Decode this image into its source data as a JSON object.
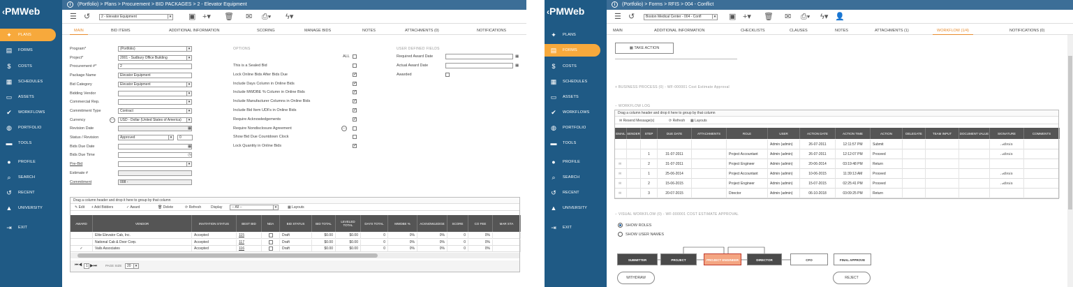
{
  "sidebar": {
    "logo": "PMWeb",
    "items": [
      {
        "label": "PLANS",
        "icon": "bulb-icon"
      },
      {
        "label": "FORMS",
        "icon": "forms-icon"
      },
      {
        "label": "COSTS",
        "icon": "dollar-icon"
      },
      {
        "label": "SCHEDULES",
        "icon": "calendar-icon"
      },
      {
        "label": "ASSETS",
        "icon": "assets-icon"
      },
      {
        "label": "WORKFLOWS",
        "icon": "check-icon"
      },
      {
        "label": "PORTFOLIO",
        "icon": "globe-icon"
      },
      {
        "label": "TOOLS",
        "icon": "toolbox-icon"
      },
      {
        "label": "PROFILE",
        "icon": "avatar-icon"
      },
      {
        "label": "SEARCH",
        "icon": "search-icon"
      },
      {
        "label": "RECENT",
        "icon": "history-icon"
      },
      {
        "label": "UNIVERSITY",
        "icon": "graduation-icon"
      },
      {
        "label": "EXIT",
        "icon": "exit-icon"
      }
    ]
  },
  "left": {
    "breadcrumb": "(Portfolio) > Plans > Procurement > BID PACKAGES > 2 - Elevator Equipment",
    "record_select": "2 - Elevator Equipment",
    "tabs": [
      "MAIN",
      "BID ITEMS",
      "ADDITIONAL INFORMATION",
      "SCORING",
      "MANAGE BIDS",
      "NOTES",
      "ATTACHMENTS (0)",
      "NOTIFICATIONS"
    ],
    "fields": [
      {
        "label": "Program*",
        "value": "(Portfolio)"
      },
      {
        "label": "Project*",
        "value": "2001 - Sudbury Office Building"
      },
      {
        "label": "Procurement #*",
        "value": "2"
      },
      {
        "label": "Package Name",
        "value": "Elevator Equipment"
      },
      {
        "label": "Bid Category",
        "value": "Elevator Equipment"
      },
      {
        "label": "Bidding Vendor",
        "value": ""
      },
      {
        "label": "Commercial Rep.",
        "value": ""
      },
      {
        "label": "Commitment Type",
        "value": "Contract"
      },
      {
        "label": "Currency",
        "value": "USD - Dollar (United States of America)"
      },
      {
        "label": "Revision Date",
        "value": ""
      },
      {
        "label": "Status / Revision",
        "value": "Approved",
        "rev": "0"
      },
      {
        "label": "Bids Due Date",
        "value": ""
      },
      {
        "label": "Bids Due Time",
        "value": ""
      },
      {
        "label": "Pre-Bid",
        "value": ""
      },
      {
        "label": "Estimate #",
        "value": ""
      },
      {
        "label": "Commitment",
        "value": "008 -"
      }
    ],
    "options_title": "OPTIONS",
    "all_label": "ALL",
    "options": [
      {
        "label": "This is a Sealed Bid",
        "checked": false
      },
      {
        "label": "Lock Online Bids After Bids Due",
        "checked": true
      },
      {
        "label": "Include Days Column in Online Bids",
        "checked": true
      },
      {
        "label": "Include MWDBE % Column in Online Bids",
        "checked": true
      },
      {
        "label": "Include Manufacturer Columns in Online Bids",
        "checked": true
      },
      {
        "label": "Include Bid Item UDFs in Online Bids",
        "checked": true
      },
      {
        "label": "Require Acknowledgements",
        "checked": true
      },
      {
        "label": "Require Nondisclosure Agreement",
        "checked": false
      },
      {
        "label": "Show Bid Due Countdown Clock",
        "checked": false
      },
      {
        "label": "Lock Quantity in Online Bids",
        "checked": true
      }
    ],
    "udf_title": "USER DEFINED FIELDS",
    "udf": [
      {
        "label": "Required Award Date"
      },
      {
        "label": "Actual Award Date"
      },
      {
        "label": "Awarded"
      }
    ],
    "grid": {
      "group_hint": "Drag a column header and drop it here to group by that column",
      "toolbar": {
        "edit": "Edit",
        "add": "Add Bidders",
        "award": "Award",
        "delete": "Delete",
        "refresh": "Refresh",
        "display": "Display",
        "display_value": "-- All --",
        "layouts": "Layouts"
      },
      "headers": [
        "AWARD",
        "VENDOR",
        "INVITATION STATUS",
        "BEST BID",
        "NDA",
        "BID STATUS",
        "BID TOTAL",
        "LEVELED TOTAL",
        "DAYS TOTAL",
        "MWDBE %",
        "ACKNOWLEDGE",
        "SCORE",
        "CO FEE",
        "MAR STA"
      ],
      "rows": [
        {
          "award": "",
          "vendor": "Elite Elevator Cab, Inc.",
          "inv": "Accepted",
          "best": "115",
          "status": "Draft",
          "total": "$0.00",
          "lev": "$0.00",
          "days": "0",
          "mw": "0%",
          "ack": "0%",
          "score": "0",
          "fee": "0%"
        },
        {
          "award": "",
          "vendor": "National Cab & Door Corp.",
          "inv": "Accepted",
          "best": "117",
          "status": "Draft",
          "total": "$0.00",
          "lev": "$0.00",
          "days": "0",
          "mw": "0%",
          "ack": "0%",
          "score": "0",
          "fee": "0%"
        },
        {
          "award": "✓",
          "vendor": "Vails Associates",
          "inv": "Accepted",
          "best": "116",
          "status": "Draft",
          "total": "$0.00",
          "lev": "$0.00",
          "days": "0",
          "mw": "0%",
          "ack": "0%",
          "score": "0",
          "fee": "0%"
        }
      ],
      "pager": {
        "page": "1",
        "size_label": "PAGE SIZE",
        "size": "20"
      }
    }
  },
  "right": {
    "breadcrumb": "(Portfolio) > Forms > RFIS > 004 - Conflict",
    "record_select": "Boston Medical Center - 004 - Confl",
    "tabs": [
      "MAIN",
      "ADDITIONAL INFORMATION",
      "CHECKLISTS",
      "CLAUSES",
      "NOTES",
      "ATTACHMENTS (1)",
      "WORKFLOW (1/4)",
      "NOTIFICATIONS (0)"
    ],
    "take_action": "TAKE ACTION",
    "business_process": "BUSINESS PROCESS (0) - WF-000001 Cost Estimate Approval",
    "workflow_log": "WORKFLOW LOG",
    "group_hint": "Drag a column header and drop it here to group by that column",
    "log_toolbar": {
      "resend": "Resend Message(s)",
      "refresh": "Refresh",
      "layouts": "Layouts"
    },
    "log_headers": [
      "EMAIL",
      "SENDER",
      "STEP",
      "DUE DATE",
      "ATTACHMENTS",
      "ROLE",
      "USER",
      "ACTION DATE",
      "ACTION TIME",
      "ACTION",
      "DELEGATE",
      "TEAM INPUT",
      "DOCUMENT VALUE",
      "SIGNATURE",
      "COMMENTS"
    ],
    "log_rows": [
      {
        "step": "",
        "due": "",
        "role": "",
        "user": "Admin (admin)",
        "adate": "26-07-2011",
        "atime": "12:11:57 PM",
        "action": "Submit",
        "sig": true
      },
      {
        "step": "1",
        "due": "31-07-2011",
        "role": "Project Accountant",
        "user": "Admin (admin)",
        "adate": "26-07-2011",
        "atime": "12:12:07 PM",
        "action": "Proceed",
        "sig": true
      },
      {
        "step": "2",
        "due": "31-07-2011",
        "role": "Project Engineer",
        "user": "Admin (admin)",
        "adate": "20-06-2014",
        "atime": "03:19:48 PM",
        "action": "Return",
        "sig": false
      },
      {
        "step": "1",
        "due": "25-06-2014",
        "role": "Project Accountant",
        "user": "Admin (admin)",
        "adate": "10-06-2015",
        "atime": "11:39:13 AM",
        "action": "Proceed",
        "sig": true
      },
      {
        "step": "2",
        "due": "15-06-2015",
        "role": "Project Engineer",
        "user": "Admin (admin)",
        "adate": "15-07-2015",
        "atime": "02:25:41 PM",
        "action": "Proceed",
        "sig": true
      },
      {
        "step": "3",
        "due": "20-07-2015",
        "role": "Director",
        "user": "Admin (admin)",
        "adate": "06-10-2018",
        "atime": "03:09:25 PM",
        "action": "Return",
        "sig": false
      }
    ],
    "visual_workflow": "VISUAL WORKFLOW (0) - WF-000001 COST ESTIMATE APPROVAL",
    "show_roles": "SHOW ROLES",
    "show_users": "SHOW USER NAMES",
    "nodes": [
      "SUBMITTER",
      "PROJECT ACCOUNTANT",
      "PROJECT ENGINEER",
      "DIRECTOR",
      "CFO",
      "FINAL APPROVE"
    ],
    "withdraw": "WITHDRAW",
    "reject": "REJECT"
  },
  "colors": {
    "sidebar": "#1f5a85",
    "topbar": "#3c6e97",
    "accent": "#f7a93c",
    "node_dark": "#4a4a4a",
    "node_active": "#f4a582"
  }
}
